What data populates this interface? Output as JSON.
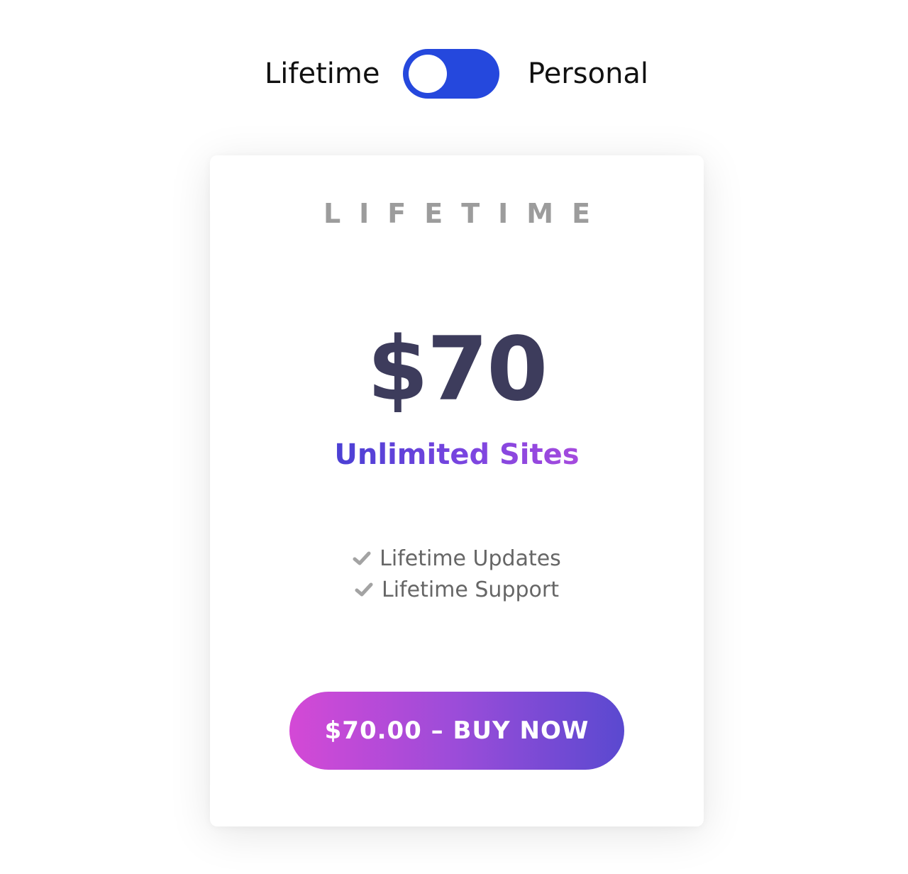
{
  "toggle": {
    "left_label": "Lifetime",
    "right_label": "Personal",
    "color": "#2548dd"
  },
  "plan": {
    "name": "LIFETIME",
    "price": "$70",
    "sites": "Unlimited Sites",
    "features": [
      {
        "icon": "check-icon",
        "label": "Lifetime Updates"
      },
      {
        "icon": "check-icon",
        "label": "Lifetime Support"
      }
    ],
    "buy_label": "$70.00 – BUY NOW"
  },
  "colors": {
    "price_text": "#3d3c5c",
    "plan_name_text": "#9c9c9c",
    "feature_text": "#666666",
    "button_gradient_start": "#d449d6",
    "button_gradient_end": "#5a49d0"
  }
}
